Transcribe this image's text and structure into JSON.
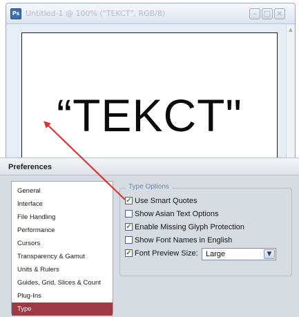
{
  "document_window": {
    "app_icon": "Ps",
    "title": "Untitled-1 @ 100% (\"TEKCT\", RGB/8)",
    "canvas_text": "“TEKCT\"",
    "minimize_icon": "minimize-icon",
    "maximize_icon": "maximize-icon",
    "close_icon": "close-icon"
  },
  "preferences": {
    "title": "Preferences",
    "categories": [
      {
        "label": "General"
      },
      {
        "label": "Interface"
      },
      {
        "label": "File Handling"
      },
      {
        "label": "Performance"
      },
      {
        "label": "Cursors"
      },
      {
        "label": "Transparency & Gamut"
      },
      {
        "label": "Units & Rulers"
      },
      {
        "label": "Guides, Grid, Slices & Count"
      },
      {
        "label": "Plug-Ins"
      },
      {
        "label": "Type"
      }
    ],
    "selected_category": "Type",
    "type_options": {
      "group_title": "Type Options",
      "use_smart_quotes": {
        "label": "Use Smart Quotes",
        "checked": true
      },
      "show_asian_text_options": {
        "label": "Show Asian Text Options",
        "checked": false
      },
      "enable_missing_glyph_protection": {
        "label": "Enable Missing Glyph Protection",
        "checked": true
      },
      "show_font_names_in_english": {
        "label": "Show Font Names in English",
        "checked": false
      },
      "font_preview_size": {
        "label": "Font Preview Size:",
        "checked": true,
        "value": "Large"
      }
    }
  },
  "colors": {
    "selected_category_bg": "#9c3a45",
    "annotation_arrow": "#e03030",
    "group_title": "#6a86b4"
  }
}
